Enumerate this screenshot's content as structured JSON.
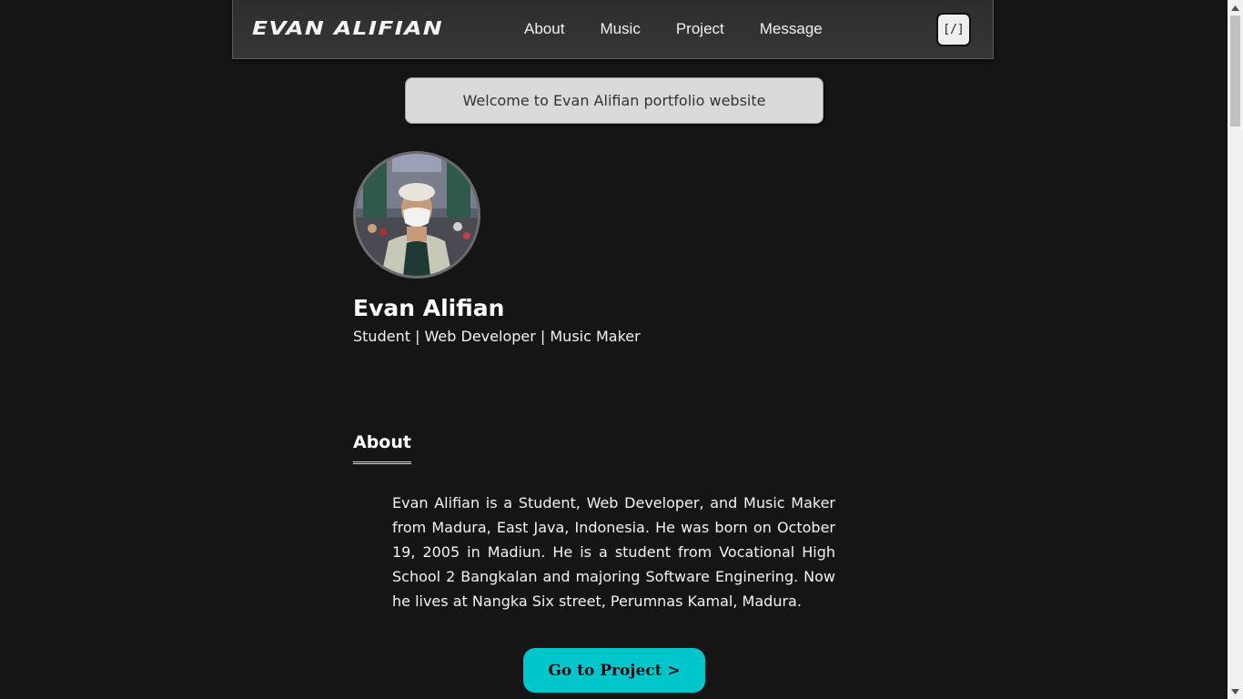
{
  "navbar": {
    "brand": "EVAN ALIFIAN",
    "links": [
      {
        "label": "About"
      },
      {
        "label": "Music"
      },
      {
        "label": "Project"
      },
      {
        "label": "Message"
      }
    ],
    "code_button": "[/]"
  },
  "welcome": "Welcome to Evan Alifian portfolio website",
  "profile": {
    "name": "Evan Alifian",
    "tagline": "Student | Web Developer | Music Maker"
  },
  "about": {
    "heading": "About",
    "text": "Evan Alifian is a Student, Web Developer, and Music Maker from Madura, East Java, Indonesia. He was born on October 19, 2005 in Madiun. He is a student from Vocational High School 2 Bangkalan and majoring Software Enginering. Now he lives at Nangka Six street, Perumnas Kamal, Madura."
  },
  "cta": {
    "project_button": "Go to Project >"
  },
  "colors": {
    "background": "#151515",
    "accent": "#00c6cc",
    "navbar": "#333333"
  }
}
